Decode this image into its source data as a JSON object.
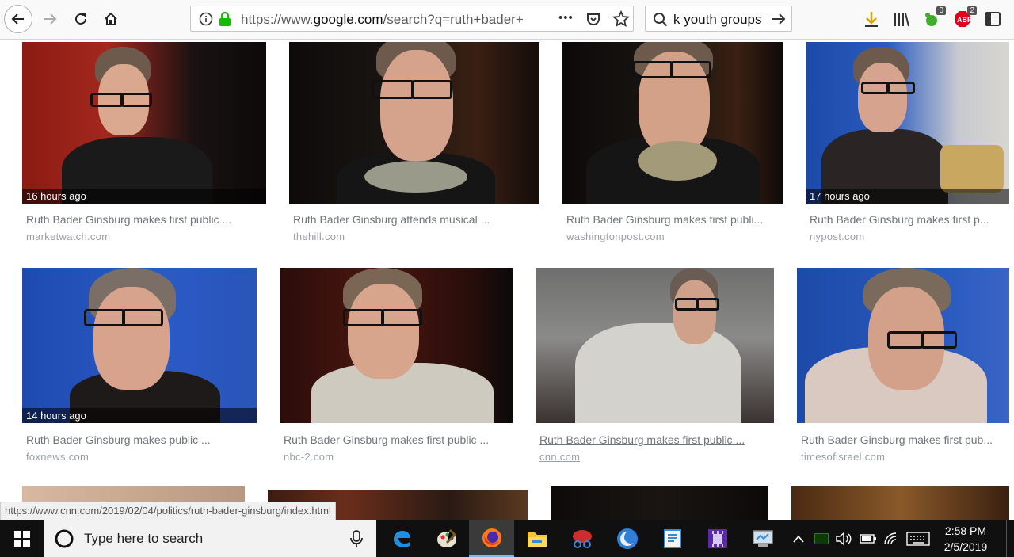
{
  "browser": {
    "url_prefix": "https://www.",
    "url_host": "google.com",
    "url_path": "/search?q=ruth+bader+",
    "search_text": "k youth groups",
    "library_badge": "0",
    "abp_badge": "2",
    "overflow_glyph": "•••"
  },
  "results": [
    {
      "title": "Ruth Bader Ginsburg makes first public ...",
      "source": "marketwatch.com",
      "time": "16 hours ago"
    },
    {
      "title": "Ruth Bader Ginsburg attends musical ...",
      "source": "thehill.com",
      "time": ""
    },
    {
      "title": "Ruth Bader Ginsburg makes first publi...",
      "source": "washingtonpost.com",
      "time": ""
    },
    {
      "title": "Ruth Bader Ginsburg makes first p...",
      "source": "nypost.com",
      "time": "17 hours ago"
    },
    {
      "title": "Ruth Bader Ginsburg makes public ...",
      "source": "foxnews.com",
      "time": "14 hours ago"
    },
    {
      "title": "Ruth Bader Ginsburg makes first public ...",
      "source": "nbc-2.com",
      "time": ""
    },
    {
      "title": "Ruth Bader Ginsburg makes first public ...",
      "source": "cnn.com",
      "time": ""
    },
    {
      "title": "Ruth Bader Ginsburg makes first pub...",
      "source": "timesofisrael.com",
      "time": ""
    }
  ],
  "status_url": "https://www.cnn.com/2019/02/04/politics/ruth-bader-ginsburg/index.html",
  "taskbar": {
    "search_placeholder": "Type here to search",
    "time": "2:58 PM",
    "date": "2/5/2019"
  }
}
